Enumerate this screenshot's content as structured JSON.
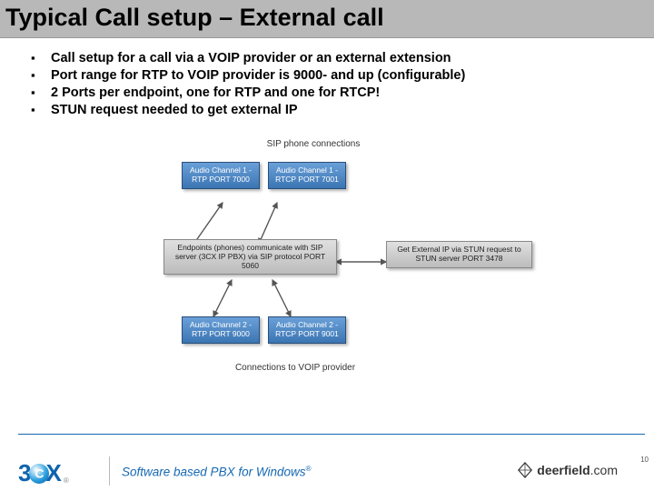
{
  "title": "Typical Call setup – External call",
  "bullets": [
    "Call setup for a call via a VOIP provider or an external extension",
    "Port range for RTP to VOIP provider is 9000- and up (configurable)",
    "2 Ports per endpoint, one for RTP and one for RTCP!",
    "STUN request needed to get external IP"
  ],
  "diagram": {
    "top_label": "SIP phone connections",
    "bottom_label": "Connections to VOIP provider",
    "boxes": {
      "tl": "Audio Channel 1 - RTP\nPORT 7000",
      "tr": "Audio Channel 1 - RTCP\nPORT 7001",
      "ml": "Endpoints (phones) communicate with SIP server (3CX IP PBX) via SIP protocol\nPORT 5060",
      "mr": "Get External IP via STUN request to STUN server\nPORT 3478",
      "bl": "Audio Channel 2 - RTP\nPORT 9000",
      "br": "Audio Channel 2 - RTCP\nPORT 9001"
    }
  },
  "footer": {
    "brand_3": "3",
    "brand_x": "X",
    "brand_reg": "®",
    "tagline": "Software based PBX for Windows",
    "deerfield": "deerfield",
    "deerfield_suffix": ".com",
    "page": "10"
  }
}
